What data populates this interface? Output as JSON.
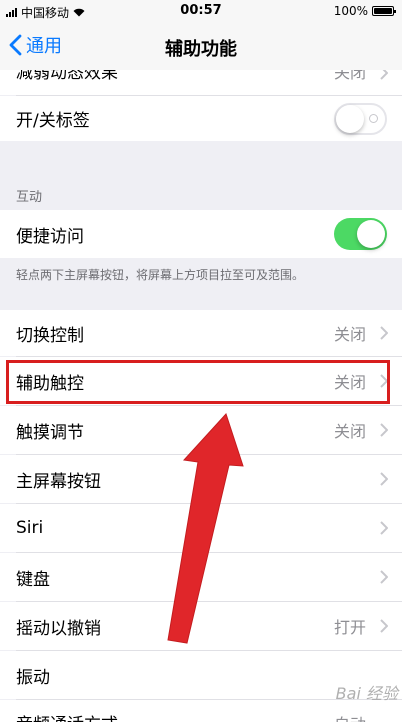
{
  "status_bar": {
    "carrier": "中国移动",
    "time": "00:57",
    "battery": "100%",
    "battery_fill": 1.0
  },
  "nav": {
    "back_label": "通用",
    "title": "辅助功能"
  },
  "rows_top": [
    {
      "label": "减弱动态效果",
      "value": "关闭"
    },
    {
      "label": "开/关标签",
      "switch_on": false
    }
  ],
  "interaction": {
    "header": "互动",
    "reachability": {
      "label": "便捷访问",
      "switch_on": true
    },
    "note": "轻点两下主屏幕按钮，将屏幕上方项目拉至可及范围。"
  },
  "rows": [
    {
      "label": "切换控制",
      "value": "关闭"
    },
    {
      "label": "辅助触控",
      "value": "关闭"
    },
    {
      "label": "触摸调节",
      "value": "关闭"
    },
    {
      "label": "主屏幕按钮",
      "value": ""
    },
    {
      "label": "Siri",
      "value": ""
    },
    {
      "label": "键盘",
      "value": ""
    },
    {
      "label": "摇动以撤销",
      "value": "打开"
    },
    {
      "label": "振动",
      "value": ""
    },
    {
      "label": "音频通话方式",
      "value": "自动"
    }
  ],
  "watermark": "Bai 经验",
  "colors": {
    "accent": "#0a7aff",
    "switch_on": "#4cd964",
    "annotation": "#d81e1e"
  }
}
